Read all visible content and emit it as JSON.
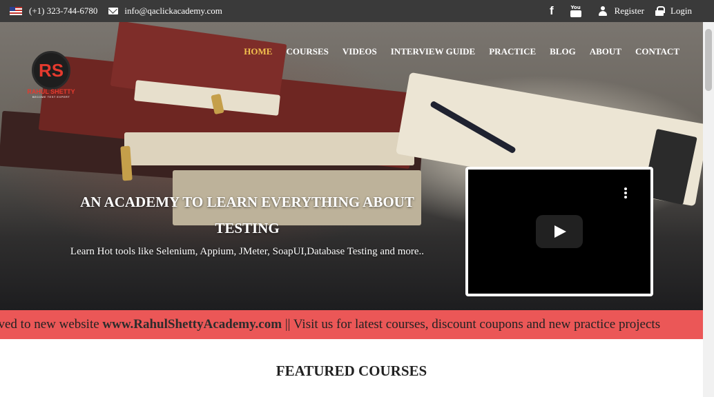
{
  "topbar": {
    "flag_icon": "us-flag-icon",
    "phone": "(+1) 323-744-6780",
    "email": "info@qaclickacademy.com",
    "facebook_icon": "facebook-icon",
    "youtube_icon": "youtube-icon",
    "youtube_glyph": "You",
    "register": "Register",
    "login": "Login"
  },
  "logo": {
    "monogram": "RS",
    "name": "RAHUL SHETTY",
    "tagline": "BECOME TEST EXPERT"
  },
  "nav": {
    "items": [
      {
        "label": "HOME",
        "active": true
      },
      {
        "label": "COURSES",
        "active": false
      },
      {
        "label": "VIDEOS",
        "active": false
      },
      {
        "label": "INTERVIEW GUIDE",
        "active": false
      },
      {
        "label": "PRACTICE",
        "active": false
      },
      {
        "label": "BLOG",
        "active": false
      },
      {
        "label": "ABOUT",
        "active": false
      },
      {
        "label": "CONTACT",
        "active": false
      }
    ],
    "active_color": "#f2c14e"
  },
  "hero": {
    "title": "AN ACADEMY TO LEARN EVERYTHING ABOUT TESTING",
    "subtitle": "Learn Hot tools like Selenium, Appium, JMeter, SoapUI,Database Testing and more.."
  },
  "video": {
    "play_icon": "play-icon",
    "menu_icon": "kebab-menu-icon"
  },
  "marquee": {
    "prefix": "oved to new website ",
    "site": "www.RahulShettyAcademy.com",
    "suffix": " || Visit us for latest courses, discount coupons and new practice projects",
    "background": "#eb5757"
  },
  "featured": {
    "heading": "FEATURED COURSES"
  }
}
